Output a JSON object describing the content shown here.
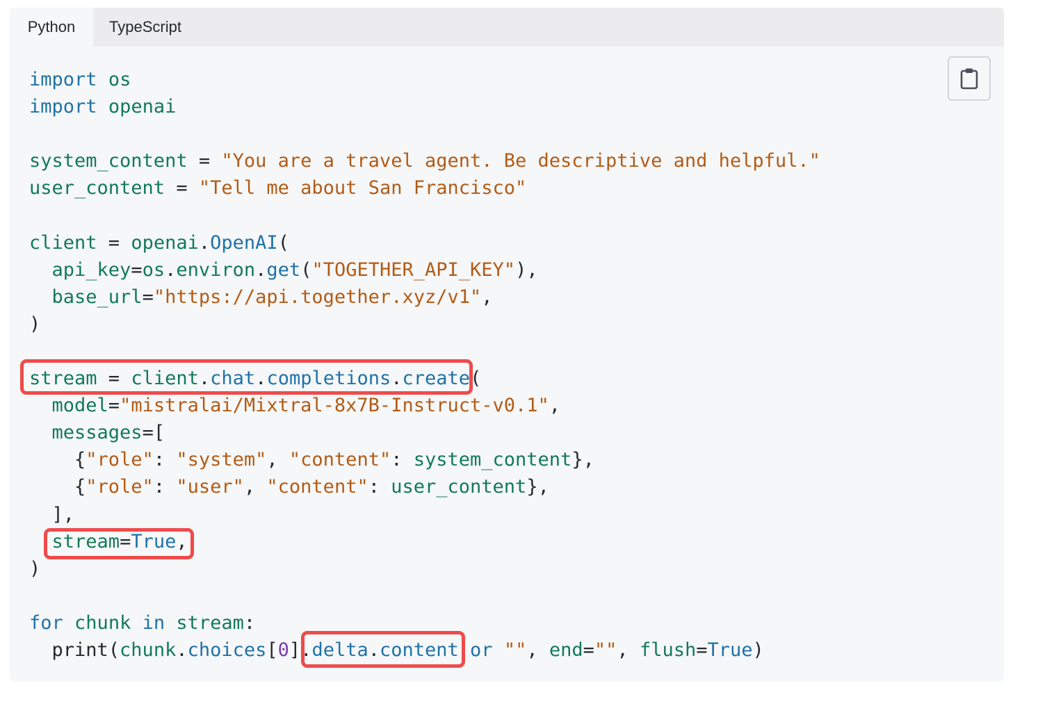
{
  "tabs": [
    {
      "label": "Python",
      "active": true
    },
    {
      "label": "TypeScript",
      "active": false
    }
  ],
  "copy_button": {
    "icon": "clipboard-icon"
  },
  "colors": {
    "keyword": "#1f72a7",
    "identifier": "#127a59",
    "string": "#b35b16",
    "number": "#7c3aad",
    "highlight": "#ef4b4b",
    "code_bg": "#f6f7f8",
    "tab_bar_bg": "#ececee"
  },
  "code": {
    "language": "python",
    "lines": [
      [
        {
          "t": "import",
          "c": "kw"
        },
        {
          "t": " ",
          "c": "op"
        },
        {
          "t": "os",
          "c": "id"
        }
      ],
      [
        {
          "t": "import",
          "c": "kw"
        },
        {
          "t": " ",
          "c": "op"
        },
        {
          "t": "openai",
          "c": "id"
        }
      ],
      [],
      [
        {
          "t": "system_content",
          "c": "id"
        },
        {
          "t": " = ",
          "c": "op"
        },
        {
          "t": "\"You are a travel agent. Be descriptive and helpful.\"",
          "c": "str"
        }
      ],
      [
        {
          "t": "user_content",
          "c": "id"
        },
        {
          "t": " = ",
          "c": "op"
        },
        {
          "t": "\"Tell me about San Francisco\"",
          "c": "str"
        }
      ],
      [],
      [
        {
          "t": "client",
          "c": "id"
        },
        {
          "t": " = ",
          "c": "op"
        },
        {
          "t": "openai",
          "c": "id"
        },
        {
          "t": ".",
          "c": "op"
        },
        {
          "t": "OpenAI",
          "c": "fn"
        },
        {
          "t": "(",
          "c": "op"
        }
      ],
      [
        {
          "t": "  ",
          "c": "op"
        },
        {
          "t": "api_key",
          "c": "id"
        },
        {
          "t": "=",
          "c": "op"
        },
        {
          "t": "os",
          "c": "id"
        },
        {
          "t": ".",
          "c": "op"
        },
        {
          "t": "environ",
          "c": "id"
        },
        {
          "t": ".",
          "c": "op"
        },
        {
          "t": "get",
          "c": "fn"
        },
        {
          "t": "(",
          "c": "op"
        },
        {
          "t": "\"TOGETHER_API_KEY\"",
          "c": "str"
        },
        {
          "t": "),",
          "c": "op"
        }
      ],
      [
        {
          "t": "  ",
          "c": "op"
        },
        {
          "t": "base_url",
          "c": "id"
        },
        {
          "t": "=",
          "c": "op"
        },
        {
          "t": "\"https://api.together.xyz/v1\"",
          "c": "str"
        },
        {
          "t": ",",
          "c": "op"
        }
      ],
      [
        {
          "t": ")",
          "c": "op"
        }
      ],
      [],
      [
        {
          "t": "stream",
          "c": "id"
        },
        {
          "t": " = ",
          "c": "op"
        },
        {
          "t": "client",
          "c": "id"
        },
        {
          "t": ".",
          "c": "op"
        },
        {
          "t": "chat",
          "c": "fn"
        },
        {
          "t": ".",
          "c": "op"
        },
        {
          "t": "completions",
          "c": "fn"
        },
        {
          "t": ".",
          "c": "op"
        },
        {
          "t": "create",
          "c": "fn"
        },
        {
          "t": "(",
          "c": "op"
        }
      ],
      [
        {
          "t": "  ",
          "c": "op"
        },
        {
          "t": "model",
          "c": "id"
        },
        {
          "t": "=",
          "c": "op"
        },
        {
          "t": "\"mistralai/Mixtral-8x7B-Instruct-v0.1\"",
          "c": "str"
        },
        {
          "t": ",",
          "c": "op"
        }
      ],
      [
        {
          "t": "  ",
          "c": "op"
        },
        {
          "t": "messages",
          "c": "id"
        },
        {
          "t": "=[",
          "c": "op"
        }
      ],
      [
        {
          "t": "    {",
          "c": "op"
        },
        {
          "t": "\"role\"",
          "c": "str"
        },
        {
          "t": ": ",
          "c": "op"
        },
        {
          "t": "\"system\"",
          "c": "str"
        },
        {
          "t": ", ",
          "c": "op"
        },
        {
          "t": "\"content\"",
          "c": "str"
        },
        {
          "t": ": ",
          "c": "op"
        },
        {
          "t": "system_content",
          "c": "id"
        },
        {
          "t": "},",
          "c": "op"
        }
      ],
      [
        {
          "t": "    {",
          "c": "op"
        },
        {
          "t": "\"role\"",
          "c": "str"
        },
        {
          "t": ": ",
          "c": "op"
        },
        {
          "t": "\"user\"",
          "c": "str"
        },
        {
          "t": ", ",
          "c": "op"
        },
        {
          "t": "\"content\"",
          "c": "str"
        },
        {
          "t": ": ",
          "c": "op"
        },
        {
          "t": "user_content",
          "c": "id"
        },
        {
          "t": "},",
          "c": "op"
        }
      ],
      [
        {
          "t": "  ],",
          "c": "op"
        }
      ],
      [
        {
          "t": "  ",
          "c": "op"
        },
        {
          "t": "stream",
          "c": "id"
        },
        {
          "t": "=",
          "c": "op"
        },
        {
          "t": "True",
          "c": "kw"
        },
        {
          "t": ",",
          "c": "op"
        }
      ],
      [
        {
          "t": ")",
          "c": "op"
        }
      ],
      [],
      [
        {
          "t": "for",
          "c": "kw"
        },
        {
          "t": " ",
          "c": "op"
        },
        {
          "t": "chunk",
          "c": "id"
        },
        {
          "t": " ",
          "c": "op"
        },
        {
          "t": "in",
          "c": "kw"
        },
        {
          "t": " ",
          "c": "op"
        },
        {
          "t": "stream",
          "c": "id"
        },
        {
          "t": ":",
          "c": "op"
        }
      ],
      [
        {
          "t": "  print(",
          "c": "op"
        },
        {
          "t": "chunk",
          "c": "id"
        },
        {
          "t": ".",
          "c": "op"
        },
        {
          "t": "choices",
          "c": "fn"
        },
        {
          "t": "[",
          "c": "op"
        },
        {
          "t": "0",
          "c": "num"
        },
        {
          "t": "].",
          "c": "op"
        },
        {
          "t": "delta",
          "c": "fn"
        },
        {
          "t": ".",
          "c": "op"
        },
        {
          "t": "content",
          "c": "fn"
        },
        {
          "t": " ",
          "c": "op"
        },
        {
          "t": "or",
          "c": "kw"
        },
        {
          "t": " ",
          "c": "op"
        },
        {
          "t": "\"\"",
          "c": "str"
        },
        {
          "t": ", ",
          "c": "op"
        },
        {
          "t": "end",
          "c": "id"
        },
        {
          "t": "=",
          "c": "op"
        },
        {
          "t": "\"\"",
          "c": "str"
        },
        {
          "t": ", ",
          "c": "op"
        },
        {
          "t": "flush",
          "c": "id"
        },
        {
          "t": "=",
          "c": "op"
        },
        {
          "t": "True",
          "c": "kw"
        },
        {
          "t": ")",
          "c": "op"
        }
      ]
    ]
  }
}
